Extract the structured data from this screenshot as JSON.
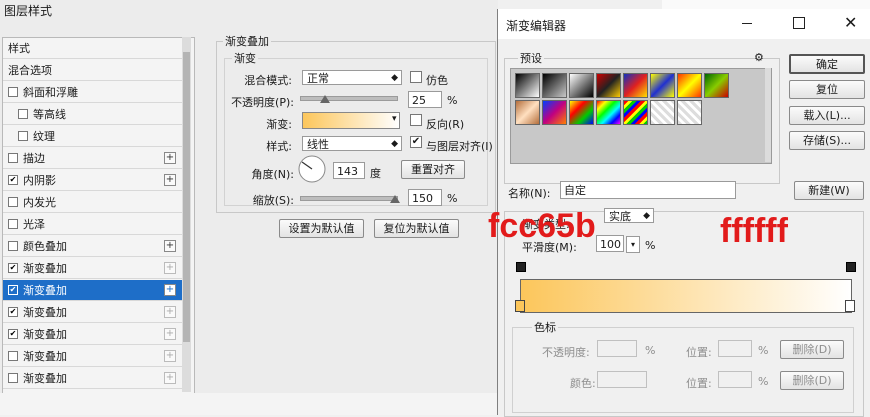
{
  "layer_style": {
    "title": "图层样式",
    "list_header": "样式",
    "items": [
      {
        "label": "混合选项",
        "check": false,
        "checked": false,
        "plus": false,
        "indent": false
      },
      {
        "label": "斜面和浮雕",
        "check": true,
        "checked": false,
        "plus": false,
        "indent": false
      },
      {
        "label": "等高线",
        "check": true,
        "checked": false,
        "plus": false,
        "indent": true
      },
      {
        "label": "纹理",
        "check": true,
        "checked": false,
        "plus": false,
        "indent": true
      },
      {
        "label": "描边",
        "check": true,
        "checked": false,
        "plus": true,
        "indent": false
      },
      {
        "label": "内阴影",
        "check": true,
        "checked": true,
        "plus": true,
        "indent": false
      },
      {
        "label": "内发光",
        "check": true,
        "checked": false,
        "plus": false,
        "indent": false
      },
      {
        "label": "光泽",
        "check": true,
        "checked": false,
        "plus": false,
        "indent": false
      },
      {
        "label": "颜色叠加",
        "check": true,
        "checked": false,
        "plus": true,
        "indent": false
      },
      {
        "label": "渐变叠加",
        "check": true,
        "checked": true,
        "plus": true,
        "indent": false
      },
      {
        "label": "渐变叠加",
        "check": true,
        "checked": true,
        "plus": true,
        "indent": false,
        "selected": true
      },
      {
        "label": "渐变叠加",
        "check": true,
        "checked": true,
        "plus": true,
        "indent": false
      },
      {
        "label": "渐变叠加",
        "check": true,
        "checked": true,
        "plus": true,
        "indent": false
      },
      {
        "label": "渐变叠加",
        "check": true,
        "checked": false,
        "plus": true,
        "indent": false
      },
      {
        "label": "渐变叠加",
        "check": true,
        "checked": false,
        "plus": true,
        "indent": false
      }
    ],
    "group_title": "渐变叠加",
    "subgroup_title": "渐变",
    "blend_mode_label": "混合模式:",
    "blend_mode_value": "正常",
    "dither_label": "仿色",
    "opacity_label": "不透明度(P):",
    "opacity_value": "25",
    "opacity_unit": "%",
    "gradient_label": "渐变:",
    "reverse_label": "反向(R)",
    "style_label": "样式:",
    "style_value": "线性",
    "align_label": "与图层对齐(I)",
    "angle_label": "角度(N):",
    "angle_value": "143",
    "angle_unit": "度",
    "reset_align_label": "重置对齐",
    "scale_label": "缩放(S):",
    "scale_value": "150",
    "scale_unit": "%",
    "make_default_label": "设置为默认值",
    "reset_default_label": "复位为默认值"
  },
  "gradient_editor": {
    "title": "渐变编辑器",
    "presets_label": "预设",
    "gear": "⚙",
    "ok_label": "确定",
    "reset_label": "复位",
    "load_label": "载入(L)...",
    "save_label": "存储(S)...",
    "name_label": "名称(N):",
    "name_value": "自定",
    "new_label": "新建(W)",
    "type_label": "渐变类型:",
    "type_value": "实底",
    "smooth_label": "平滑度(M):",
    "smooth_value": "100",
    "smooth_unit": "%",
    "stops_label": "色标",
    "stop_opacity_label": "不透明度:",
    "stop_location_label": "位置:",
    "stop_delete_label": "删除(D)",
    "stop_color_label": "颜色:",
    "percent": "%",
    "start_color": "#fcc65b",
    "end_color": "#ffffff"
  },
  "annotations": {
    "left_hex": "fcc65b",
    "right_hex": "ffffff"
  },
  "colors": {
    "selection": "#1e6ec8",
    "annotation": "#e21b1b"
  }
}
